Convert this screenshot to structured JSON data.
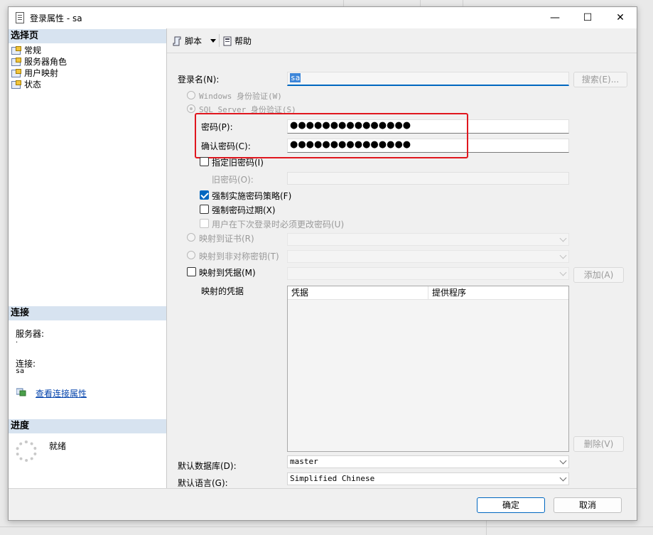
{
  "window": {
    "title": "登录属性 - sa",
    "minimize": "—",
    "maximize": "☐",
    "close": "✕"
  },
  "sidebar": {
    "select_page_header": "选择页",
    "items": [
      {
        "label": "常规"
      },
      {
        "label": "服务器角色"
      },
      {
        "label": "用户映射"
      },
      {
        "label": "状态"
      }
    ],
    "connection_header": "连接",
    "server_label": "服务器:",
    "server_value": ".",
    "connection_label": "连接:",
    "connection_value": "sa",
    "view_conn_props": "查看连接属性",
    "progress_header": "进度",
    "progress_status": "就绪"
  },
  "toolbar": {
    "script_label": "脚本",
    "help_label": "帮助"
  },
  "form": {
    "login_name_label": "登录名(N):",
    "login_name_value": "sa",
    "search_button": "搜索(E)...",
    "windows_auth": "Windows 身份验证(W)",
    "sql_auth": "SQL Server 身份验证(S)",
    "password_label": "密码(P):",
    "password_value": "●●●●●●●●●●●●●●●",
    "confirm_label": "确认密码(C):",
    "confirm_value": "●●●●●●●●●●●●●●●",
    "old_pwd_check": "指定旧密码(I)",
    "old_pwd_label": "旧密码(O):",
    "enforce_policy": "强制实施密码策略(F)",
    "enforce_expiration": "强制密码过期(X)",
    "must_change": "用户在下次登录时必须更改密码(U)",
    "map_cert": "映射到证书(R)",
    "map_asym": "映射到非对称密钥(T)",
    "map_cred": "映射到凭据(M)",
    "add_button": "添加(A)",
    "mapped_creds_label": "映射的凭据",
    "col_credential": "凭据",
    "col_provider": "提供程序",
    "remove_button": "删除(V)",
    "default_db_label": "默认数据库(D):",
    "default_db_value": "master",
    "default_lang_label": "默认语言(G):",
    "default_lang_value": "Simplified Chinese"
  },
  "footer": {
    "ok": "确定",
    "cancel": "取消"
  }
}
